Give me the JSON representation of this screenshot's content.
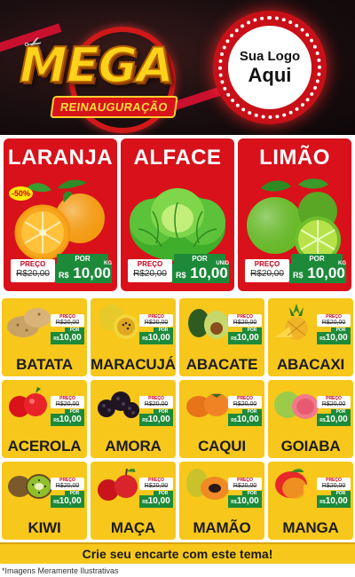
{
  "header": {
    "title": "MEGA",
    "subtitle": "REINAUGURAÇÃO",
    "logo_line1": "Sua Logo",
    "logo_line2": "Aqui"
  },
  "featured": [
    {
      "name": "LARANJA",
      "discount": "-50%",
      "preco_label": "PREÇO",
      "old_price": "R$20,00",
      "por_label": "POR",
      "currency": "R$",
      "price": "10,00",
      "unit": "KG",
      "icon": "orange-icon"
    },
    {
      "name": "ALFACE",
      "discount": "",
      "preco_label": "PREÇO",
      "old_price": "R$20,00",
      "por_label": "POR",
      "currency": "R$",
      "price": "10,00",
      "unit": "UNID",
      "icon": "lettuce-icon"
    },
    {
      "name": "LIMÃO",
      "discount": "",
      "preco_label": "PREÇO",
      "old_price": "R$20,00",
      "por_label": "POR",
      "currency": "R$",
      "price": "10,00",
      "unit": "KG",
      "icon": "lime-icon"
    }
  ],
  "grid": [
    {
      "name": "BATATA",
      "icon": "potato-icon",
      "preco_label": "PREÇO",
      "old_price": "R$20,00",
      "por_label": "POR",
      "currency": "R$",
      "price": "10,00"
    },
    {
      "name": "MARACUJÁ",
      "icon": "passionfruit-icon",
      "preco_label": "PREÇO",
      "old_price": "R$20,00",
      "por_label": "POR",
      "currency": "R$",
      "price": "10,00"
    },
    {
      "name": "ABACATE",
      "icon": "avocado-icon",
      "preco_label": "PREÇO",
      "old_price": "R$20,00",
      "por_label": "POR",
      "currency": "R$",
      "price": "10,00"
    },
    {
      "name": "ABACAXI",
      "icon": "pineapple-icon",
      "preco_label": "PREÇO",
      "old_price": "R$20,00",
      "por_label": "POR",
      "currency": "R$",
      "price": "10,00"
    },
    {
      "name": "ACEROLA",
      "icon": "acerola-icon",
      "preco_label": "PREÇO",
      "old_price": "R$20,00",
      "por_label": "POR",
      "currency": "R$",
      "price": "10,00"
    },
    {
      "name": "AMORA",
      "icon": "blackberry-icon",
      "preco_label": "PREÇO",
      "old_price": "R$20,00",
      "por_label": "POR",
      "currency": "R$",
      "price": "10,00"
    },
    {
      "name": "CAQUI",
      "icon": "persimmon-icon",
      "preco_label": "PREÇO",
      "old_price": "R$20,00",
      "por_label": "POR",
      "currency": "R$",
      "price": "10,00"
    },
    {
      "name": "GOIABA",
      "icon": "guava-icon",
      "preco_label": "PREÇO",
      "old_price": "R$20,00",
      "por_label": "POR",
      "currency": "R$",
      "price": "10,00"
    },
    {
      "name": "KIWI",
      "icon": "kiwi-icon",
      "preco_label": "PREÇO",
      "old_price": "R$20,00",
      "por_label": "POR",
      "currency": "R$",
      "price": "10,00"
    },
    {
      "name": "MAÇA",
      "icon": "apple-icon",
      "preco_label": "PREÇO",
      "old_price": "R$20,00",
      "por_label": "POR",
      "currency": "R$",
      "price": "10,00"
    },
    {
      "name": "MAMÃO",
      "icon": "papaya-icon",
      "preco_label": "PREÇO",
      "old_price": "R$20,00",
      "por_label": "POR",
      "currency": "R$",
      "price": "10,00"
    },
    {
      "name": "MANGA",
      "icon": "mango-icon",
      "preco_label": "PREÇO",
      "old_price": "R$20,00",
      "por_label": "POR",
      "currency": "R$",
      "price": "10,00"
    }
  ],
  "footer": {
    "cta": "Crie seu encarte com este tema!",
    "disclaimer": "*Imagens Meramente Ilustrativas"
  },
  "colors": {
    "header_bg": "#1a0e10",
    "featured_card": "#d8111b",
    "grid_card": "#f7c71b",
    "price_green": "#1d8a3a",
    "title_yellow": "#ffd21a"
  }
}
